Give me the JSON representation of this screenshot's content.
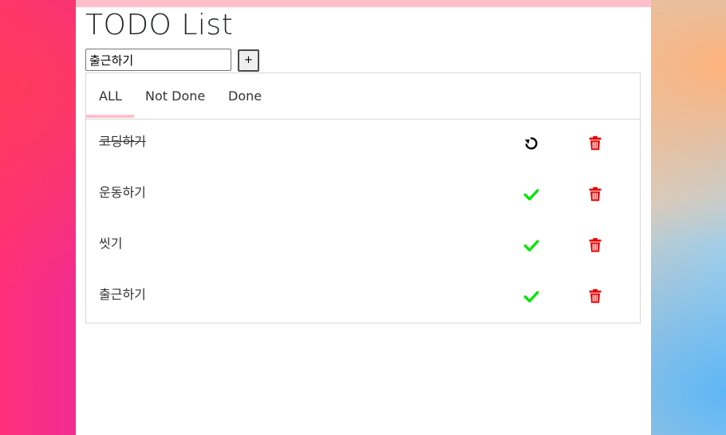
{
  "app": {
    "title": "TODO List"
  },
  "input": {
    "value": "출근하기",
    "add_label": "+"
  },
  "tabs": [
    {
      "label": "ALL",
      "active": true
    },
    {
      "label": "Not Done",
      "active": false
    },
    {
      "label": "Done",
      "active": false
    }
  ],
  "tasks": [
    {
      "text": "코딩하기",
      "done": true,
      "status_icon": "undo-icon",
      "delete_icon": "trash-icon"
    },
    {
      "text": "운동하기",
      "done": false,
      "status_icon": "check-icon",
      "delete_icon": "trash-icon"
    },
    {
      "text": "씻기",
      "done": false,
      "status_icon": "check-icon",
      "delete_icon": "trash-icon"
    },
    {
      "text": "출근하기",
      "done": false,
      "status_icon": "check-icon",
      "delete_icon": "trash-icon"
    }
  ],
  "colors": {
    "accent_pink": "#ffc0cb",
    "check_green": "#00e600",
    "delete_red": "#e60000",
    "undo_black": "#000000"
  }
}
